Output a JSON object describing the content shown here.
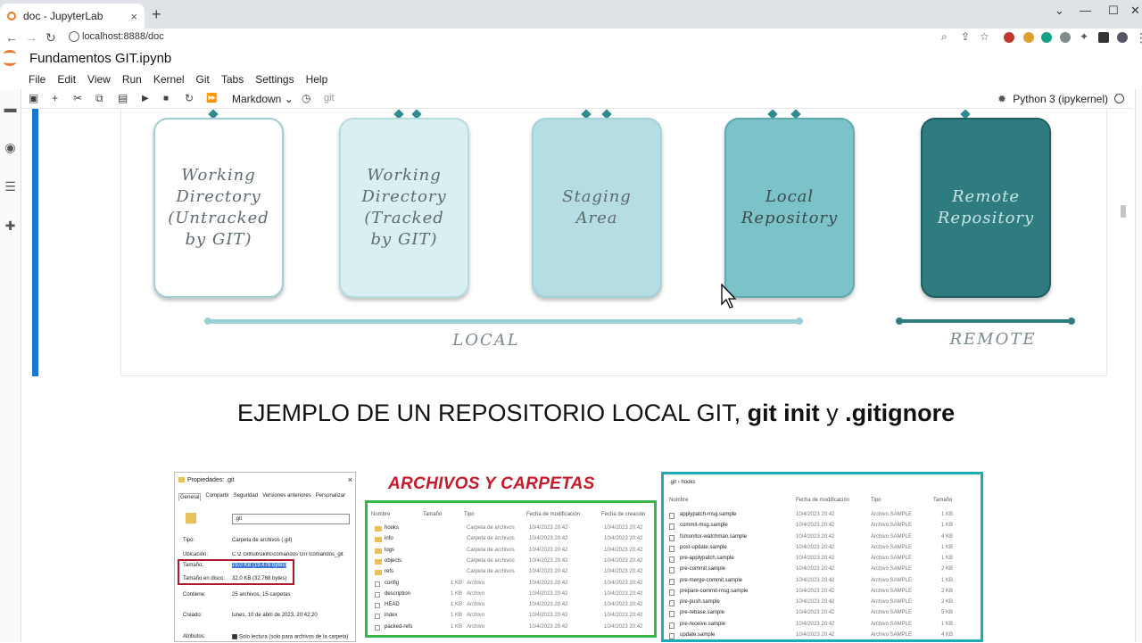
{
  "browser": {
    "tab_title": "doc - JupyterLab",
    "tab_close": "×",
    "new_tab": "+",
    "url": "localhost:8888/doc",
    "window_controls": [
      "⌄",
      "—",
      "☐",
      "✕"
    ]
  },
  "notebook": {
    "title": "Fundamentos GIT.ipynb",
    "menu": [
      "File",
      "Edit",
      "View",
      "Run",
      "Kernel",
      "Git",
      "Tabs",
      "Settings",
      "Help"
    ],
    "cell_type": "Markdown",
    "git_label": "git",
    "kernel": "Python 3 (ipykernel)"
  },
  "diagram": {
    "boxes": [
      {
        "label": "Working Directory (Untracked by GIT)",
        "fill": "#ffffff",
        "border": "#9fd0d4",
        "color": "#5e6b70"
      },
      {
        "label": "Working Directory (Tracked by GIT)",
        "fill": "#daeff1",
        "border": "#b5dde0",
        "color": "#5e6b70"
      },
      {
        "label": "Staging Area",
        "fill": "#b5dde3",
        "border": "#a3d2d8",
        "color": "#5e6b70"
      },
      {
        "label": "Local Repository",
        "fill": "#7bc3c8",
        "border": "#5fa9b0",
        "color": "#3d4a4f"
      },
      {
        "label": "Remote Repository",
        "fill": "#2f7c80",
        "border": "#1f5e62",
        "color": "#c9e3e5"
      }
    ],
    "local_label": "LOCAL",
    "remote_label": "REMOTE"
  },
  "heading": {
    "prefix": "EJEMPLO DE UN REPOSITORIO LOCAL GIT, ",
    "bold1": "git init",
    "mid": " y ",
    "bold2": ".gitignore"
  },
  "properties": {
    "title": "Propiedades: .git",
    "close": "×",
    "tabs": [
      "General",
      "Compartir",
      "Seguridad",
      "Versiones anteriores",
      "Personalizar"
    ],
    "name": ".git",
    "rows": [
      {
        "label": "Tipo:",
        "value": "Carpeta de archivos (.git)"
      },
      {
        "label": "Ubicación:",
        "value": "C:\\z Github\\skills\\comandos GIT\\comandos_git"
      },
      {
        "label": "Tamaño:",
        "value": "19,0 KB (19.478 bytes)"
      },
      {
        "label": "Tamaño en disco:",
        "value": "32,0 KB (32.768 bytes)"
      },
      {
        "label": "Contiene:",
        "value": "25 archivos, 15 carpetas"
      },
      {
        "label": "Creado:",
        "value": "lunes, 10 de abril de 2023, 20:42:20"
      },
      {
        "label": "Atributos:",
        "value": "Solo lectura (solo para archivos de la carpeta)"
      }
    ]
  },
  "archivos": {
    "title": "ARCHIVOS Y CARPETAS",
    "headers": [
      "Nombre",
      "Tamaño",
      "Tipo",
      "Fecha de modificación",
      "Fecha de creación"
    ],
    "rows": [
      {
        "name": "hooks",
        "size": "",
        "type": "Carpeta de archivos",
        "mod": "10/4/2023 20:42",
        "created": "10/4/2023 20:42",
        "folder": true
      },
      {
        "name": "info",
        "size": "",
        "type": "Carpeta de archivos",
        "mod": "10/4/2023 20:42",
        "created": "10/4/2023 20:42",
        "folder": true
      },
      {
        "name": "logs",
        "size": "",
        "type": "Carpeta de archivos",
        "mod": "10/4/2023 20:42",
        "created": "10/4/2023 20:42",
        "folder": true
      },
      {
        "name": "objects",
        "size": "",
        "type": "Carpeta de archivos",
        "mod": "10/4/2023 20:42",
        "created": "10/4/2023 20:42",
        "folder": true
      },
      {
        "name": "refs",
        "size": "",
        "type": "Carpeta de archivos",
        "mod": "10/4/2023 20:42",
        "created": "10/4/2023 20:42",
        "folder": true
      },
      {
        "name": "config",
        "size": "1 KB",
        "type": "Archivo",
        "mod": "10/4/2023 20:42",
        "created": "10/4/2023 20:42",
        "folder": false
      },
      {
        "name": "description",
        "size": "1 KB",
        "type": "Archivo",
        "mod": "10/4/2023 20:42",
        "created": "10/4/2023 20:42",
        "folder": false
      },
      {
        "name": "HEAD",
        "size": "1 KB",
        "type": "Archivo",
        "mod": "10/4/2023 20:42",
        "created": "10/4/2023 20:42",
        "folder": false
      },
      {
        "name": "index",
        "size": "1 KB",
        "type": "Archivo",
        "mod": "10/4/2023 20:42",
        "created": "10/4/2023 20:42",
        "folder": false
      },
      {
        "name": "packed-refs",
        "size": "1 KB",
        "type": "Archivo",
        "mod": "10/4/2023 20:42",
        "created": "10/4/2023 20:42",
        "folder": false
      }
    ]
  },
  "hooks": {
    "crumb_root": ".git",
    "crumb_sep": "›",
    "crumb_leaf": "hooks",
    "headers": [
      "Nombre",
      "Fecha de modificación",
      "Tipo",
      "Tamaño"
    ],
    "rows": [
      {
        "name": "applypatch-msg.sample",
        "mod": "10/4/2023 20:42",
        "type": "Archivo SAMPLE",
        "size": "1 KB"
      },
      {
        "name": "commit-msg.sample",
        "mod": "10/4/2023 20:42",
        "type": "Archivo SAMPLE",
        "size": "1 KB"
      },
      {
        "name": "fsmonitor-watchman.sample",
        "mod": "10/4/2023 20:42",
        "type": "Archivo SAMPLE",
        "size": "4 KB"
      },
      {
        "name": "post-update.sample",
        "mod": "10/4/2023 20:42",
        "type": "Archivo SAMPLE",
        "size": "1 KB"
      },
      {
        "name": "pre-applypatch.sample",
        "mod": "10/4/2023 20:42",
        "type": "Archivo SAMPLE",
        "size": "1 KB"
      },
      {
        "name": "pre-commit.sample",
        "mod": "10/4/2023 20:42",
        "type": "Archivo SAMPLE",
        "size": "2 KB"
      },
      {
        "name": "pre-merge-commit.sample",
        "mod": "10/4/2023 20:42",
        "type": "Archivo SAMPLE",
        "size": "1 KB"
      },
      {
        "name": "prepare-commit-msg.sample",
        "mod": "10/4/2023 20:42",
        "type": "Archivo SAMPLE",
        "size": "2 KB"
      },
      {
        "name": "pre-push.sample",
        "mod": "10/4/2023 20:42",
        "type": "Archivo SAMPLE",
        "size": "2 KB"
      },
      {
        "name": "pre-rebase.sample",
        "mod": "10/4/2023 20:42",
        "type": "Archivo SAMPLE",
        "size": "5 KB"
      },
      {
        "name": "pre-receive.sample",
        "mod": "10/4/2023 20:42",
        "type": "Archivo SAMPLE",
        "size": "1 KB"
      },
      {
        "name": "update.sample",
        "mod": "10/4/2023 20:42",
        "type": "Archivo SAMPLE",
        "size": "4 KB"
      }
    ]
  },
  "colors": {
    "jupyter_orange": "#f37726",
    "active_cell": "#1976d2",
    "archivos_border": "#3ab54a",
    "archivos_title": "#c8192a",
    "hooks_border": "#1faab8",
    "size_box": "#b01830"
  }
}
